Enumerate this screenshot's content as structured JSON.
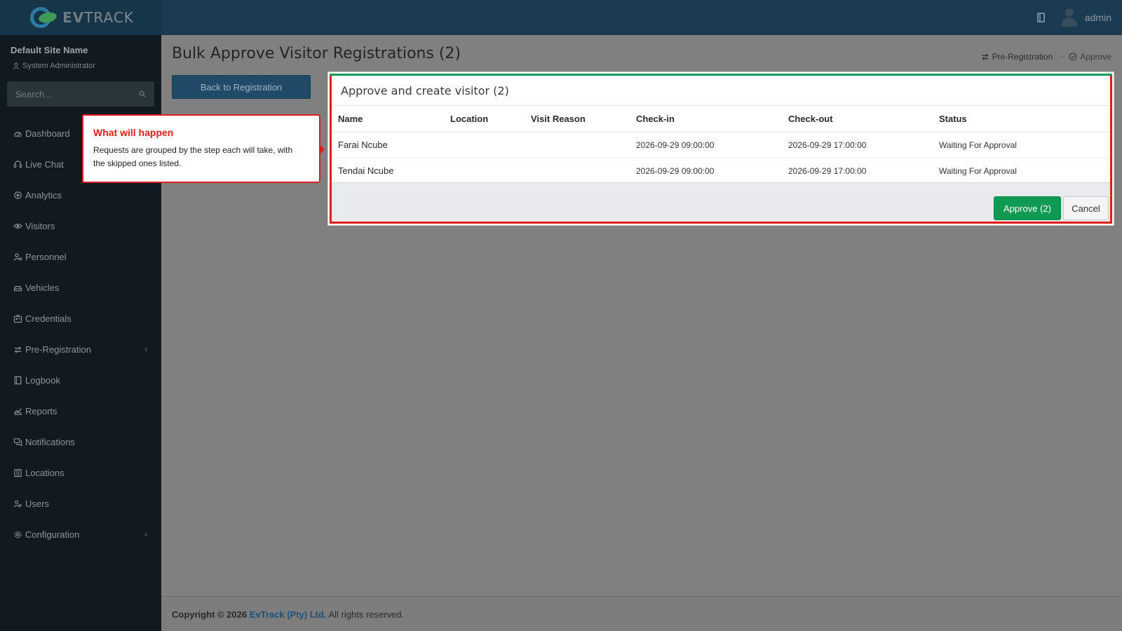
{
  "header": {
    "logo_text_bold": "EV",
    "logo_text": "TRACK",
    "user_name": "admin"
  },
  "sidebar": {
    "site_name": "Default Site Name",
    "role": "System Administrator",
    "search_placeholder": "Search...",
    "items": [
      {
        "label": "Dashboard",
        "icon": "dashboard-icon"
      },
      {
        "label": "Live Chat",
        "icon": "headset-icon"
      },
      {
        "label": "Analytics",
        "icon": "target-icon"
      },
      {
        "label": "Visitors",
        "icon": "eye-icon"
      },
      {
        "label": "Personnel",
        "icon": "user-gear-icon"
      },
      {
        "label": "Vehicles",
        "icon": "car-icon"
      },
      {
        "label": "Credentials",
        "icon": "id-card-icon"
      },
      {
        "label": "Pre-Registration",
        "icon": "arrows-exchange-icon",
        "has_submenu": true
      },
      {
        "label": "Logbook",
        "icon": "book-icon"
      },
      {
        "label": "Reports",
        "icon": "chart-icon"
      },
      {
        "label": "Notifications",
        "icon": "chat-bubbles-icon"
      },
      {
        "label": "Locations",
        "icon": "building-icon"
      },
      {
        "label": "Users",
        "icon": "users-icon"
      },
      {
        "label": "Configuration",
        "icon": "gear-icon",
        "has_submenu": true
      }
    ]
  },
  "page": {
    "title": "Bulk Approve Visitor Registrations (2)",
    "breadcrumb": [
      "Pre-Registration",
      "Approve"
    ],
    "back_button": "Back to Registration"
  },
  "modal": {
    "title": "Approve and create visitor (2)",
    "columns": [
      "Name",
      "Location",
      "Visit Reason",
      "Check-in",
      "Check-out",
      "Status"
    ],
    "rows": [
      {
        "name": "Farai Ncube",
        "location": "",
        "visit_reason": "",
        "check_in": "2026-09-29 09:00:00",
        "check_out": "2026-09-29 17:00:00",
        "status": "Waiting For Approval"
      },
      {
        "name": "Tendai Ncube",
        "location": "",
        "visit_reason": "",
        "check_in": "2026-09-29 09:00:00",
        "check_out": "2026-09-29 17:00:00",
        "status": "Waiting For Approval"
      }
    ],
    "approve_button": "Approve (2)",
    "cancel_button": "Cancel"
  },
  "callout": {
    "title": "What will happen",
    "text": "Requests are grouped by the step each will take, with the skipped ones listed."
  },
  "footer": {
    "prefix": "Copyright © 2026",
    "company": "EvTrack (Pty) Ltd.",
    "suffix": "All rights reserved."
  },
  "colors": {
    "header_bg": "#1a3b52",
    "sidebar_bg": "#111a20",
    "accent_green": "#0e9a52",
    "callout_red": "#e11c1c"
  }
}
